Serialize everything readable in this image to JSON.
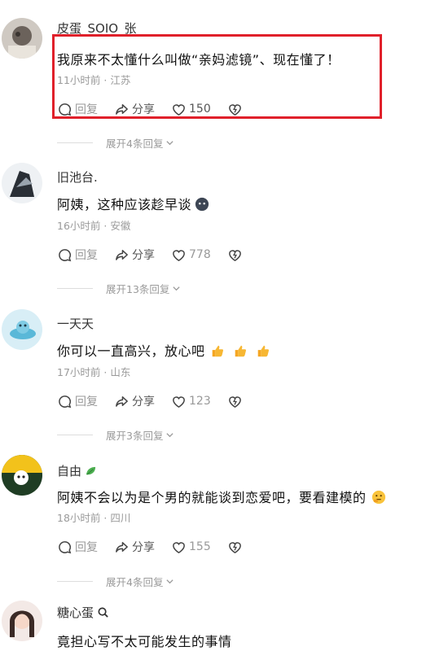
{
  "comments": [
    {
      "username": "皮蛋_SOIO_张",
      "text": "我原来不太懂什么叫做“亲妈滤镜”、现在懂了！",
      "time": "11小时前",
      "location": "江苏",
      "reply_label": "回复",
      "share_label": "分享",
      "likes": "150",
      "expand": "展开4条回复"
    },
    {
      "username": "旧池台.",
      "text": "阿姨，这种应该趁早谈",
      "time": "16小时前",
      "location": "安徽",
      "reply_label": "回复",
      "share_label": "分享",
      "likes": "778",
      "expand": "展开13条回复"
    },
    {
      "username": "一天天",
      "text": "你可以一直高兴，放心吧",
      "time": "17小时前",
      "location": "山东",
      "reply_label": "回复",
      "share_label": "分享",
      "likes": "123",
      "expand": "展开3条回复"
    },
    {
      "username": "自由",
      "text": "阿姨不会以为是个男的就能谈到恋爱吧，要看建模的",
      "time": "18小时前",
      "location": "四川",
      "reply_label": "回复",
      "share_label": "分享",
      "likes": "155",
      "expand": "展开4条回复"
    },
    {
      "username": "糖心蛋",
      "text": "竟担心写不太可能发生的事情"
    }
  ],
  "colors": {
    "highlight": "#e0202a",
    "meta": "#9a9a9a"
  },
  "icons": [
    "comment-icon",
    "share-icon",
    "heart-icon",
    "dislike-icon",
    "chevron-down-icon"
  ]
}
